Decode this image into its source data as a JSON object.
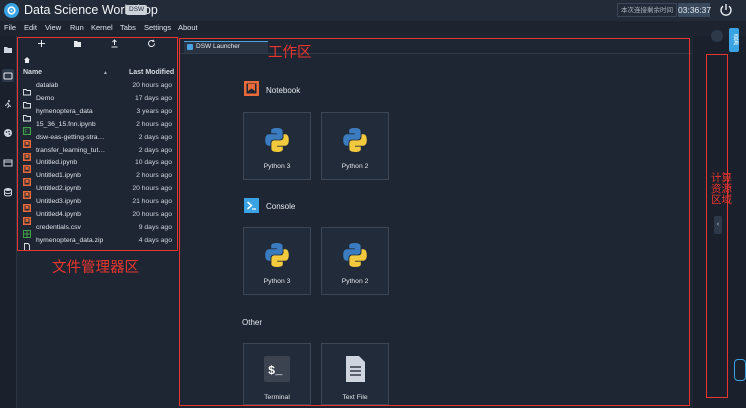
{
  "app": {
    "title": "Data Science Workshop",
    "badge": "DSW",
    "session_label": "本次连接剩余时间",
    "session_time": "03:36:37"
  },
  "menu": [
    "File",
    "Edit",
    "View",
    "Run",
    "Kernel",
    "Tabs",
    "Settings",
    "About"
  ],
  "file_browser": {
    "col_name": "Name",
    "col_modified": "Last Modified",
    "files": [
      {
        "name": "datalab",
        "modified": "20 hours ago",
        "icon": "folder-icon"
      },
      {
        "name": "Demo",
        "modified": "17 days ago",
        "icon": "folder-icon"
      },
      {
        "name": "hymenoptera_data",
        "modified": "3 years ago",
        "icon": "folder-icon"
      },
      {
        "name": "15_36_15.fnn.ipynb",
        "modified": "2 hours ago",
        "icon": "notebook-green-icon"
      },
      {
        "name": "dsw-eas-getting-stra…",
        "modified": "2 days ago",
        "icon": "notebook-icon"
      },
      {
        "name": "transfer_learning_tut…",
        "modified": "2 days ago",
        "icon": "notebook-icon"
      },
      {
        "name": "Untitled.ipynb",
        "modified": "10 days ago",
        "icon": "notebook-icon"
      },
      {
        "name": "Untitled1.ipynb",
        "modified": "2 hours ago",
        "icon": "notebook-icon"
      },
      {
        "name": "Untitled2.ipynb",
        "modified": "20 hours ago",
        "icon": "notebook-icon"
      },
      {
        "name": "Untitled3.ipynb",
        "modified": "21 hours ago",
        "icon": "notebook-icon"
      },
      {
        "name": "Untitled4.ipynb",
        "modified": "20 hours ago",
        "icon": "notebook-icon"
      },
      {
        "name": "credentials.csv",
        "modified": "9 days ago",
        "icon": "csv-icon"
      },
      {
        "name": "hymenoptera_data.zip",
        "modified": "4 days ago",
        "icon": "file-icon"
      }
    ],
    "annotation": "文件管理器区"
  },
  "launcher": {
    "tab_label": "DSW Launcher",
    "annotation": "工作区",
    "notebook_title": "Notebook",
    "console_title": "Console",
    "other_title": "Other",
    "notebook_cards": [
      "Python 3",
      "Python 2"
    ],
    "console_cards": [
      "Python 3",
      "Python 2"
    ],
    "other_cards": [
      "Terminal",
      "Text File"
    ]
  },
  "right_panel": {
    "annotation": "计算资源区域",
    "tab_label": "资源"
  },
  "colors": {
    "accent": "#3aa3e3",
    "annotation_red": "#e8352d",
    "notebook_orange": "#e86a3a"
  }
}
